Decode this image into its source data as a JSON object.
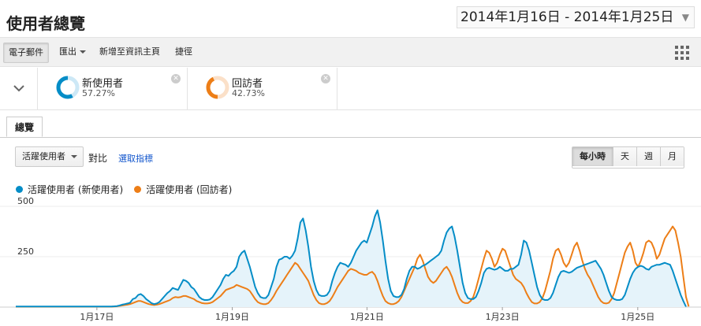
{
  "page": {
    "title": "使用者總覽",
    "date_range": "2014年1月16日 - 2014年1月25日"
  },
  "toolbar": {
    "email": "電子郵件",
    "export": "匯出",
    "add_dashboard": "新增至資訊主頁",
    "shortcut": "捷徑"
  },
  "segments": [
    {
      "name": "新使用者",
      "percent": "57.27%",
      "color": "#058dc7"
    },
    {
      "name": "回訪者",
      "percent": "42.73%",
      "color": "#ed7e17"
    }
  ],
  "tabs": {
    "overview": "總覽"
  },
  "controls": {
    "metric": "活躍使用者",
    "compare": "對比",
    "select_metric": "選取指標",
    "granularity": [
      "每小時",
      "天",
      "週",
      "月"
    ],
    "granularity_selected": "每小時"
  },
  "chart_data": {
    "type": "line",
    "x_label_unit": "hour",
    "xticks": [
      "1月17日",
      "1月19日",
      "1月21日",
      "1月23日",
      "1月25日"
    ],
    "yticks": [
      500,
      250
    ],
    "ylim": [
      0,
      500
    ],
    "grid": true,
    "legend_position": "top-left",
    "series": [
      {
        "name": "活躍使用者 (新使用者)",
        "color": "#058dc7",
        "values": [
          3,
          3,
          3,
          3,
          3,
          3,
          3,
          3,
          3,
          3,
          3,
          3,
          3,
          3,
          3,
          3,
          3,
          3,
          3,
          3,
          3,
          3,
          3,
          3,
          3,
          3,
          3,
          3,
          3,
          3,
          3,
          3,
          3,
          3,
          3,
          3,
          3,
          4,
          5,
          8,
          12,
          15,
          18,
          22,
          40,
          45,
          60,
          65,
          55,
          40,
          30,
          20,
          15,
          18,
          25,
          40,
          55,
          70,
          80,
          95,
          90,
          85,
          110,
          135,
          130,
          120,
          100,
          90,
          70,
          50,
          40,
          35,
          35,
          38,
          50,
          70,
          90,
          110,
          140,
          160,
          155,
          170,
          180,
          200,
          250,
          270,
          280,
          240,
          200,
          150,
          100,
          70,
          50,
          45,
          45,
          60,
          100,
          140,
          200,
          235,
          240,
          250,
          250,
          240,
          255,
          280,
          340,
          420,
          440,
          380,
          300,
          200,
          130,
          85,
          60,
          55,
          55,
          60,
          80,
          130,
          170,
          200,
          220,
          215,
          210,
          200,
          220,
          250,
          280,
          300,
          320,
          330,
          320,
          360,
          400,
          450,
          480,
          420,
          330,
          230,
          140,
          80,
          55,
          50,
          50,
          60,
          90,
          140,
          180,
          200,
          200,
          190,
          195,
          205,
          210,
          220,
          230,
          240,
          250,
          260,
          280,
          330,
          370,
          390,
          400,
          350,
          280,
          200,
          120,
          70,
          45,
          40,
          40,
          50,
          80,
          120,
          170,
          190,
          195,
          190,
          185,
          190,
          200,
          190,
          180,
          180,
          190,
          190,
          200,
          210,
          260,
          330,
          320,
          280,
          220,
          160,
          100,
          60,
          40,
          35,
          35,
          45,
          70,
          110,
          150,
          175,
          180,
          175,
          170,
          175,
          185,
          195,
          200,
          205,
          210,
          215,
          220,
          225,
          230,
          210,
          190,
          160,
          120,
          80,
          50,
          40,
          35,
          35,
          40,
          60,
          100,
          140,
          170,
          190,
          200,
          205,
          200,
          190,
          185,
          200,
          205,
          210,
          210,
          215,
          220,
          215,
          210,
          180,
          140,
          100,
          60,
          30,
          2
        ]
      },
      {
        "name": "活躍使用者 (回訪者)",
        "color": "#ed7e17",
        "values": [
          2,
          2,
          2,
          2,
          2,
          2,
          2,
          2,
          2,
          2,
          2,
          2,
          2,
          2,
          2,
          2,
          2,
          2,
          2,
          2,
          2,
          2,
          2,
          2,
          2,
          2,
          2,
          2,
          2,
          2,
          2,
          2,
          2,
          2,
          2,
          2,
          2,
          3,
          4,
          6,
          8,
          10,
          12,
          15,
          20,
          25,
          30,
          30,
          25,
          20,
          15,
          12,
          10,
          12,
          15,
          20,
          25,
          30,
          35,
          45,
          50,
          48,
          50,
          55,
          55,
          50,
          45,
          40,
          30,
          25,
          20,
          18,
          18,
          20,
          25,
          35,
          45,
          55,
          70,
          85,
          90,
          95,
          100,
          110,
          105,
          100,
          95,
          90,
          80,
          60,
          40,
          25,
          18,
          15,
          15,
          20,
          35,
          55,
          80,
          100,
          120,
          140,
          160,
          180,
          200,
          220,
          210,
          190,
          170,
          150,
          130,
          95,
          60,
          35,
          20,
          15,
          15,
          20,
          30,
          50,
          75,
          100,
          120,
          140,
          160,
          180,
          190,
          185,
          180,
          170,
          165,
          160,
          160,
          170,
          175,
          160,
          130,
          90,
          55,
          30,
          20,
          15,
          15,
          20,
          30,
          50,
          80,
          110,
          140,
          170,
          200,
          240,
          260,
          230,
          190,
          150,
          130,
          120,
          130,
          150,
          170,
          190,
          200,
          180,
          150,
          110,
          70,
          40,
          25,
          20,
          20,
          30,
          50,
          90,
          140,
          190,
          240,
          280,
          270,
          240,
          200,
          220,
          260,
          290,
          280,
          240,
          200,
          160,
          140,
          130,
          120,
          100,
          70,
          45,
          25,
          18,
          18,
          25,
          45,
          80,
          130,
          180,
          240,
          280,
          290,
          260,
          220,
          200,
          220,
          260,
          300,
          320,
          280,
          230,
          190,
          160,
          140,
          110,
          80,
          50,
          30,
          20,
          18,
          22,
          40,
          70,
          120,
          170,
          220,
          270,
          300,
          320,
          280,
          220,
          200,
          230,
          270,
          320,
          330,
          320,
          290,
          240,
          260,
          300,
          340,
          360,
          380,
          400,
          380,
          320,
          250,
          150,
          50,
          3
        ]
      }
    ]
  }
}
